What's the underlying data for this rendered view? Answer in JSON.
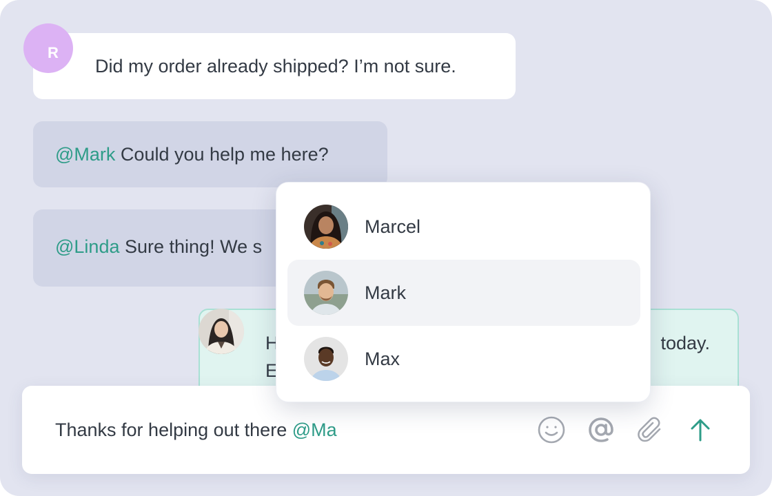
{
  "messages": {
    "customer": {
      "avatar_initial": "R",
      "text": "Did my order already shipped? I’m not sure."
    },
    "internal_note": {
      "mention": "@Mark",
      "text": " Could you help me here?"
    },
    "reply_note": {
      "mention": "@Linda",
      "text": " Sure thing! We s"
    },
    "agent_reply": {
      "line1_start": "H",
      "line1_end": "today.",
      "line2_start": "E"
    }
  },
  "mention_dropdown": {
    "options": [
      {
        "name": "Marcel",
        "selected": false
      },
      {
        "name": "Mark",
        "selected": true
      },
      {
        "name": "Max",
        "selected": false
      }
    ]
  },
  "composer": {
    "text": "Thanks for helping out there ",
    "mention": "@Ma",
    "tools": [
      "emoji-icon",
      "at-sign-icon",
      "paperclip-icon",
      "arrow-up-icon"
    ]
  },
  "colors": {
    "background": "#e2e4f0",
    "mention": "#2e9c88",
    "internal_bubble": "#d1d5e6",
    "agent_bubble": "#e0f4f0",
    "customer_avatar": "#dcb2f4"
  }
}
